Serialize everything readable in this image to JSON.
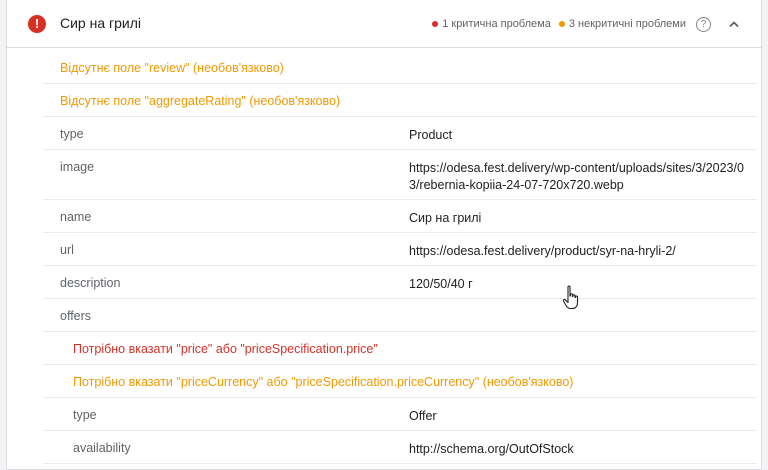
{
  "header": {
    "title": "Сир на грилі",
    "critical_issues": "1 критична проблема",
    "noncritical_issues": "3 некритичні проблеми",
    "help_glyph": "?",
    "error_glyph": "!",
    "critical_color": "#d93025",
    "warning_color": "#f29900"
  },
  "rows": [
    {
      "kind": "warning",
      "text": "Відсутнє поле \"review\" (необов'язково)"
    },
    {
      "kind": "warning",
      "text": "Відсутнє поле \"aggregateRating\" (необов'язково)"
    },
    {
      "kind": "field",
      "key": "type",
      "value": "Product"
    },
    {
      "kind": "field",
      "key": "image",
      "value": "https://odesa.fest.delivery/wp-content/uploads/sites/3/2023/03/rebernia-kopiia-24-07-720x720.webp"
    },
    {
      "kind": "field",
      "key": "name",
      "value": "Сир на грилі"
    },
    {
      "kind": "field",
      "key": "url",
      "value": "https://odesa.fest.delivery/product/syr-na-hryli-2/"
    },
    {
      "kind": "field",
      "key": "description",
      "value": "120/50/40 г"
    },
    {
      "kind": "field",
      "key": "offers",
      "value": ""
    },
    {
      "kind": "error",
      "text": "Потрібно вказати \"price\" або \"priceSpecification.price\""
    },
    {
      "kind": "warning",
      "text": "Потрібно вказати \"priceCurrency\" або \"priceSpecification.priceCurrency\" (необов'язково)"
    },
    {
      "kind": "field",
      "key": "type",
      "value": "Offer"
    },
    {
      "kind": "field",
      "key": "availability",
      "value": "http://schema.org/OutOfStock"
    }
  ]
}
